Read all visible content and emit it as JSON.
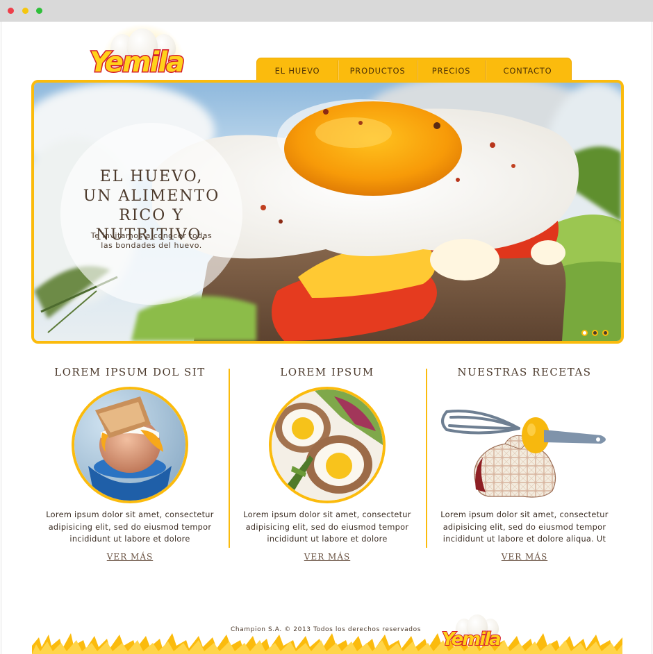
{
  "brand": {
    "name": "Yemila",
    "accent": "#fbbb0d",
    "logo_red": "#d31b2b"
  },
  "nav": {
    "items": [
      {
        "label": "EL HUEVO"
      },
      {
        "label": "PRODUCTOS"
      },
      {
        "label": "PRECIOS"
      },
      {
        "label": "CONTACTO"
      }
    ]
  },
  "hero": {
    "title": "EL HUEVO,\nUN ALIMENTO\nRICO Y NUTRITIVO.",
    "subtitle": "Te invitamos a conocer todas\nlas bondades del huevo.",
    "slides": 3,
    "active_slide": 1
  },
  "columns": [
    {
      "title": "LOREM IPSUM DOL SIT",
      "image": "boiled-egg-in-cup",
      "text": "Lorem ipsum dolor sit amet, consectetur adipisicing elit, sed do eiusmod tempor incididunt ut labore et dolore",
      "link": "VER MÁS"
    },
    {
      "title": "LOREM IPSUM",
      "image": "scotch-egg-salad",
      "text": "Lorem ipsum dolor sit amet, consectetur adipisicing elit, sed do eiusmod tempor incididunt ut labore et dolore",
      "link": "VER MÁS"
    },
    {
      "title": "NUESTRAS RECETAS",
      "image": "whisk-egg-oven-mitt",
      "text": "Lorem ipsum dolor sit amet, consectetur adipisicing elit, sed do eiusmod tempor incididunt ut labore et dolore aliqua. Ut",
      "link": "VER MÁS"
    }
  ],
  "footer": {
    "copyright": "Champion S.A. © 2013 Todos los derechos reservados"
  }
}
